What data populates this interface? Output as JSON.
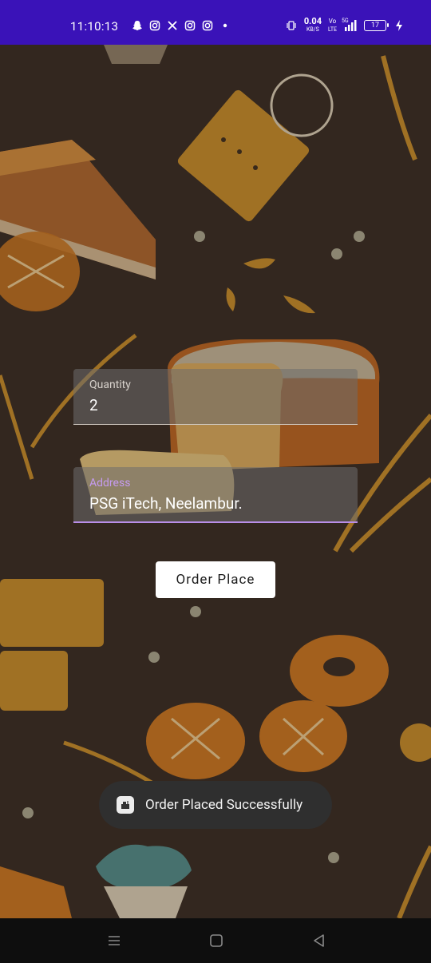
{
  "status_bar": {
    "time": "11:10:13",
    "left_icons": [
      "snapchat-icon",
      "instagram-icon",
      "x-icon",
      "instagram-icon",
      "instagram-icon",
      "dot-icon"
    ],
    "net_speed_value": "0.04",
    "net_speed_unit": "KB/S",
    "network_label_top": "Vo",
    "network_label_bottom": "LTE",
    "signal_label": "5G",
    "battery_level": "17"
  },
  "form": {
    "quantity": {
      "label": "Quantity",
      "value": "2"
    },
    "address": {
      "label": "Address",
      "value": "PSG iTech, Neelambur."
    },
    "submit_label": "Order Place"
  },
  "toast": {
    "text": "Order Placed Successfully",
    "icon": "app-icon"
  },
  "nav_bar": {
    "buttons": [
      "recents-icon",
      "home-icon",
      "back-icon"
    ]
  },
  "colors": {
    "status_bar": "#3a12b8",
    "background": "#33271f",
    "accent": "#b98ee8",
    "button": "#ffffff",
    "toast": "#2f2f2f"
  }
}
